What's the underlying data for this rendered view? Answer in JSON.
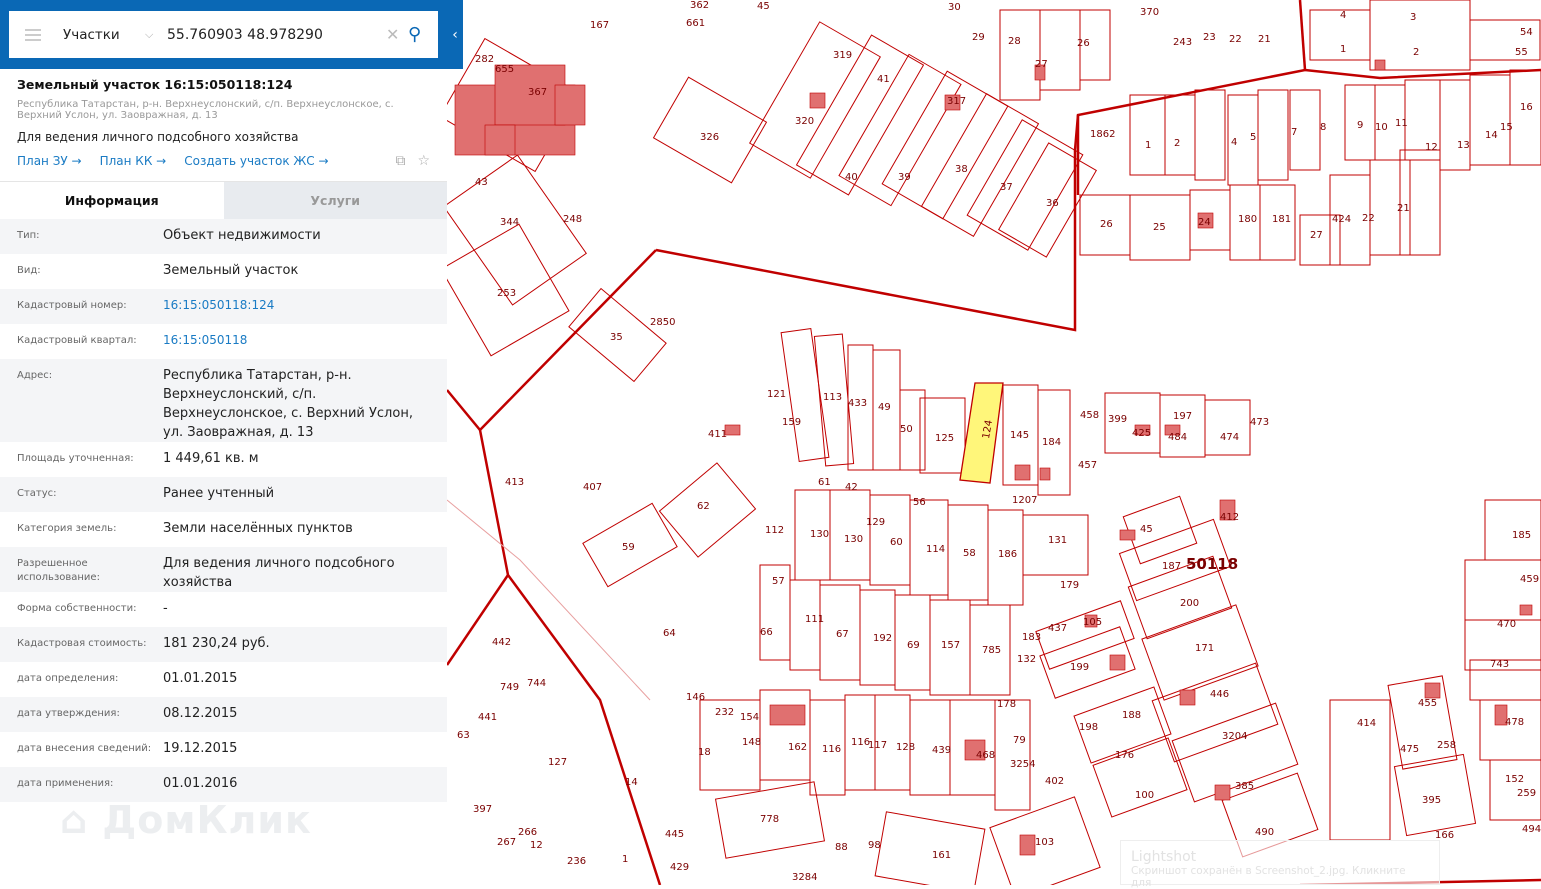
{
  "search": {
    "category": "Участки",
    "query": "55.760903 48.978290"
  },
  "parcel": {
    "title": "Земельный участок 16:15:050118:124",
    "address": "Республика Татарстан, р-н. Верхнеуслонский, с/п. Верхнеуслонское, с. Верхний Услон, ул. Заовражная, д. 13",
    "purpose": "Для ведения личного подсобного хозяйства",
    "links": [
      "План ЗУ →",
      "План КК →",
      "Создать участок ЖС →"
    ]
  },
  "tabs": [
    "Информация",
    "Услуги"
  ],
  "info": [
    {
      "k": "Тип:",
      "v": "Объект недвижимости"
    },
    {
      "k": "Вид:",
      "v": "Земельный участок"
    },
    {
      "k": "Кадастровый номер:",
      "v": "16:15:050118:124",
      "link": true
    },
    {
      "k": "Кадастровый квартал:",
      "v": "16:15:050118",
      "link": true
    },
    {
      "k": "Адрес:",
      "v": "Республика Татарстан, р-н. Верхнеуслонский, с/п. Верхнеуслонское, с. Верхний Услон, ул. Заовражная, д. 13"
    },
    {
      "k": "Площадь уточненная:",
      "v": "1 449,61 кв. м"
    },
    {
      "k": "Статус:",
      "v": "Ранее учтенный"
    },
    {
      "k": "Категория земель:",
      "v": "Земли населённых пунктов"
    },
    {
      "k": "Разрешенное использование:",
      "v": "Для ведения личного подсобного хозяйства"
    },
    {
      "k": "Форма собственности:",
      "v": "-"
    },
    {
      "k": "Кадастровая стоимость:",
      "v": "181 230,24 руб."
    },
    {
      "k": "дата определения:",
      "v": "01.01.2015"
    },
    {
      "k": "дата утверждения:",
      "v": "08.12.2015"
    },
    {
      "k": "дата внесения сведений:",
      "v": "19.12.2015"
    },
    {
      "k": "дата применения:",
      "v": "01.01.2016"
    }
  ],
  "watermark": "ДомКлик",
  "lightshot": {
    "title": "Lightshot",
    "text": "Скриншот сохранён в Screenshot_2.jpg. Кликните для"
  },
  "map": {
    "quarter_label": "50118",
    "selected_label": "124",
    "labels": [
      "362",
      "661",
      "167",
      "45",
      "30",
      "29",
      "28",
      "26",
      "370",
      "243",
      "23",
      "22",
      "21",
      "4",
      "3",
      "54",
      "55",
      "1",
      "2",
      "282",
      "655",
      "367",
      "43",
      "319",
      "41",
      "317",
      "27",
      "1862",
      "326",
      "320",
      "40",
      "39",
      "38",
      "37",
      "36",
      "1",
      "2",
      "4",
      "5",
      "7",
      "8",
      "9",
      "10",
      "11",
      "13",
      "14",
      "15",
      "16",
      "12",
      "26",
      "25",
      "24",
      "180",
      "181",
      "27",
      "424",
      "22",
      "21",
      "344",
      "248",
      "253",
      "35",
      "2850",
      "121",
      "159",
      "113",
      "433",
      "49",
      "50",
      "125",
      "145",
      "184",
      "458",
      "399",
      "425",
      "197",
      "484",
      "474",
      "473",
      "411",
      "457",
      "61",
      "42",
      "56",
      "1207",
      "413",
      "407",
      "62",
      "112",
      "130",
      "130",
      "129",
      "60",
      "114",
      "58",
      "186",
      "131",
      "45",
      "187",
      "412",
      "59",
      "57",
      "179",
      "200",
      "185",
      "459",
      "64",
      "66",
      "111",
      "67",
      "192",
      "69",
      "157",
      "785",
      "132",
      "183",
      "437",
      "105",
      "171",
      "470",
      "743",
      "749",
      "744",
      "442",
      "441",
      "63",
      "146",
      "232",
      "154",
      "148",
      "162",
      "116",
      "116",
      "117",
      "128",
      "439",
      "468",
      "79",
      "178",
      "199",
      "198",
      "188",
      "446",
      "455",
      "478",
      "475",
      "258",
      "127",
      "18",
      "3254",
      "402",
      "176",
      "3204",
      "414",
      "152",
      "259",
      "14",
      "397",
      "267",
      "266",
      "12",
      "236",
      "1",
      "445",
      "429",
      "778",
      "88",
      "98",
      "161",
      "103",
      "100",
      "385",
      "490",
      "395",
      "166",
      "494",
      "3284"
    ]
  },
  "colors": {
    "brand": "#0a68b5",
    "link": "#1a7bc4",
    "parcel_line": "#c00000",
    "selected": "#fff67a",
    "building": "#e07070"
  }
}
